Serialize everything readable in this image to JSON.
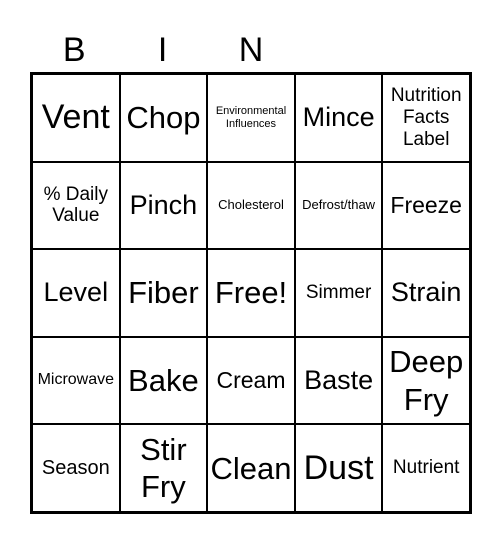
{
  "header": [
    "B",
    "I",
    "N",
    "",
    ""
  ],
  "cells": [
    [
      "Vent",
      "Chop",
      "Environmental Influences",
      "Mince",
      "Nutrition Facts Label"
    ],
    [
      "% Daily Value",
      "Pinch",
      "Cholesterol",
      "Defrost/thaw",
      "Freeze"
    ],
    [
      "Level",
      "Fiber",
      "Free!",
      "Simmer",
      "Strain"
    ],
    [
      "Microwave",
      "Bake",
      "Cream",
      "Baste",
      "Deep Fry"
    ],
    [
      "Season",
      "Stir Fry",
      "Clean",
      "Dust",
      "Nutrient"
    ]
  ]
}
